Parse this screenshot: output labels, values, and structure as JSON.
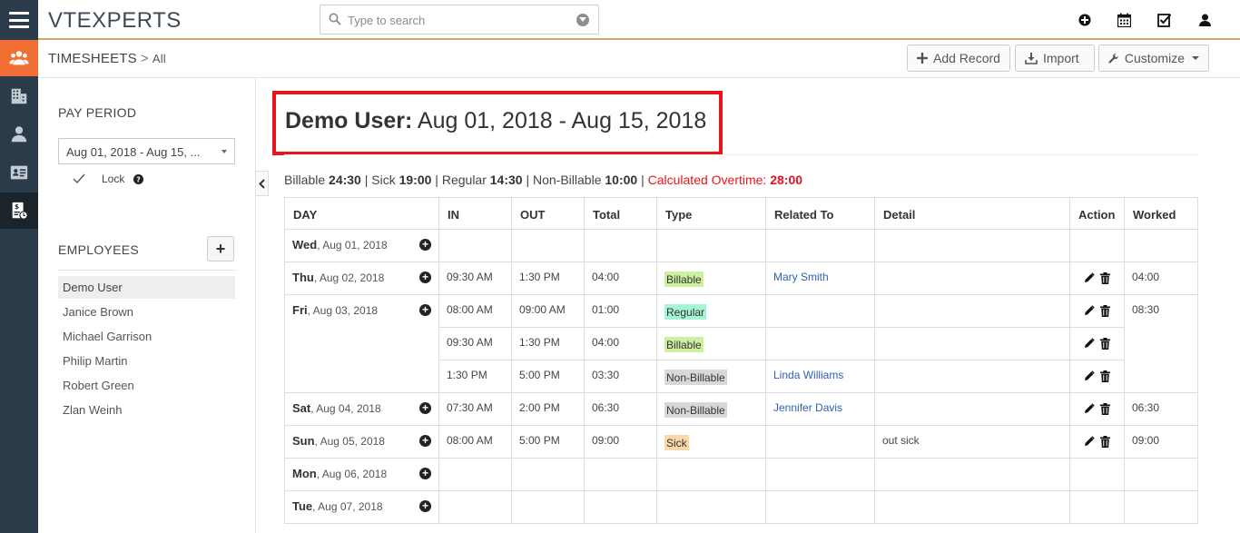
{
  "app": {
    "logo_text": "VTEXPERTS",
    "accent_color": "#f26f33"
  },
  "search": {
    "placeholder": "Type to search"
  },
  "header_icons": [
    "plus-circle-icon",
    "calendar-icon",
    "checkbox-icon",
    "user-icon"
  ],
  "breadcrumb": {
    "module": "TIMESHEETS",
    "separator": ">",
    "view": "All"
  },
  "toolbar": {
    "add_record": "Add Record",
    "import": "Import",
    "customize": "Customize"
  },
  "sidebar": {
    "pay_period_label": "PAY PERIOD",
    "pay_period_value": "Aug 01, 2018 - Aug 15, ...",
    "lock_label": "Lock",
    "employees_label": "EMPLOYEES",
    "employees": [
      "Demo User",
      "Janice Brown",
      "Michael Garrison",
      "Philip Martin",
      "Robert Green",
      "Zlan Weinh"
    ],
    "selected_employee": "Demo User"
  },
  "main": {
    "user": "Demo User:",
    "period": "Aug 01, 2018 - Aug 15, 2018",
    "summary": {
      "billable_label": "Billable",
      "billable": "24:30",
      "sick_label": "Sick",
      "sick": "19:00",
      "regular_label": "Regular",
      "regular": "14:30",
      "nonbillable_label": "Non-Billable",
      "nonbillable": "10:00",
      "overtime_label": "Calculated Overtime:",
      "overtime": "28:00"
    }
  },
  "table": {
    "headers": [
      "DAY",
      "IN",
      "OUT",
      "Total",
      "Type",
      "Related To",
      "Detail",
      "Action",
      "Worked"
    ],
    "type_colors": {
      "Billable": "#ccf0a0",
      "Regular": "#a5f5d2",
      "Non-Billable": "#d8d8d8",
      "Sick": "#fbd9a7"
    },
    "days": [
      {
        "dow": "Wed",
        "date": "Aug 01, 2018",
        "worked": "",
        "entries": []
      },
      {
        "dow": "Thu",
        "date": "Aug 02, 2018",
        "worked": "04:00",
        "entries": [
          {
            "in": "09:30 AM",
            "out": "1:30 PM",
            "total": "04:00",
            "type": "Billable",
            "related": "Mary Smith",
            "detail": ""
          }
        ]
      },
      {
        "dow": "Fri",
        "date": "Aug 03, 2018",
        "worked": "08:30",
        "entries": [
          {
            "in": "08:00 AM",
            "out": "09:00 AM",
            "total": "01:00",
            "type": "Regular",
            "related": "",
            "detail": ""
          },
          {
            "in": "09:30 AM",
            "out": "1:30 PM",
            "total": "04:00",
            "type": "Billable",
            "related": "",
            "detail": ""
          },
          {
            "in": "1:30 PM",
            "out": "5:00 PM",
            "total": "03:30",
            "type": "Non-Billable",
            "related": "Linda Williams",
            "detail": ""
          }
        ]
      },
      {
        "dow": "Sat",
        "date": "Aug 04, 2018",
        "worked": "06:30",
        "entries": [
          {
            "in": "07:30 AM",
            "out": "2:00 PM",
            "total": "06:30",
            "type": "Non-Billable",
            "related": "Jennifer Davis",
            "detail": ""
          }
        ]
      },
      {
        "dow": "Sun",
        "date": "Aug 05, 2018",
        "worked": "09:00",
        "entries": [
          {
            "in": "08:00 AM",
            "out": "5:00 PM",
            "total": "09:00",
            "type": "Sick",
            "related": "",
            "detail": "out sick"
          }
        ]
      },
      {
        "dow": "Mon",
        "date": "Aug 06, 2018",
        "worked": "",
        "entries": []
      },
      {
        "dow": "Tue",
        "date": "Aug 07, 2018",
        "worked": "",
        "entries": []
      }
    ]
  }
}
